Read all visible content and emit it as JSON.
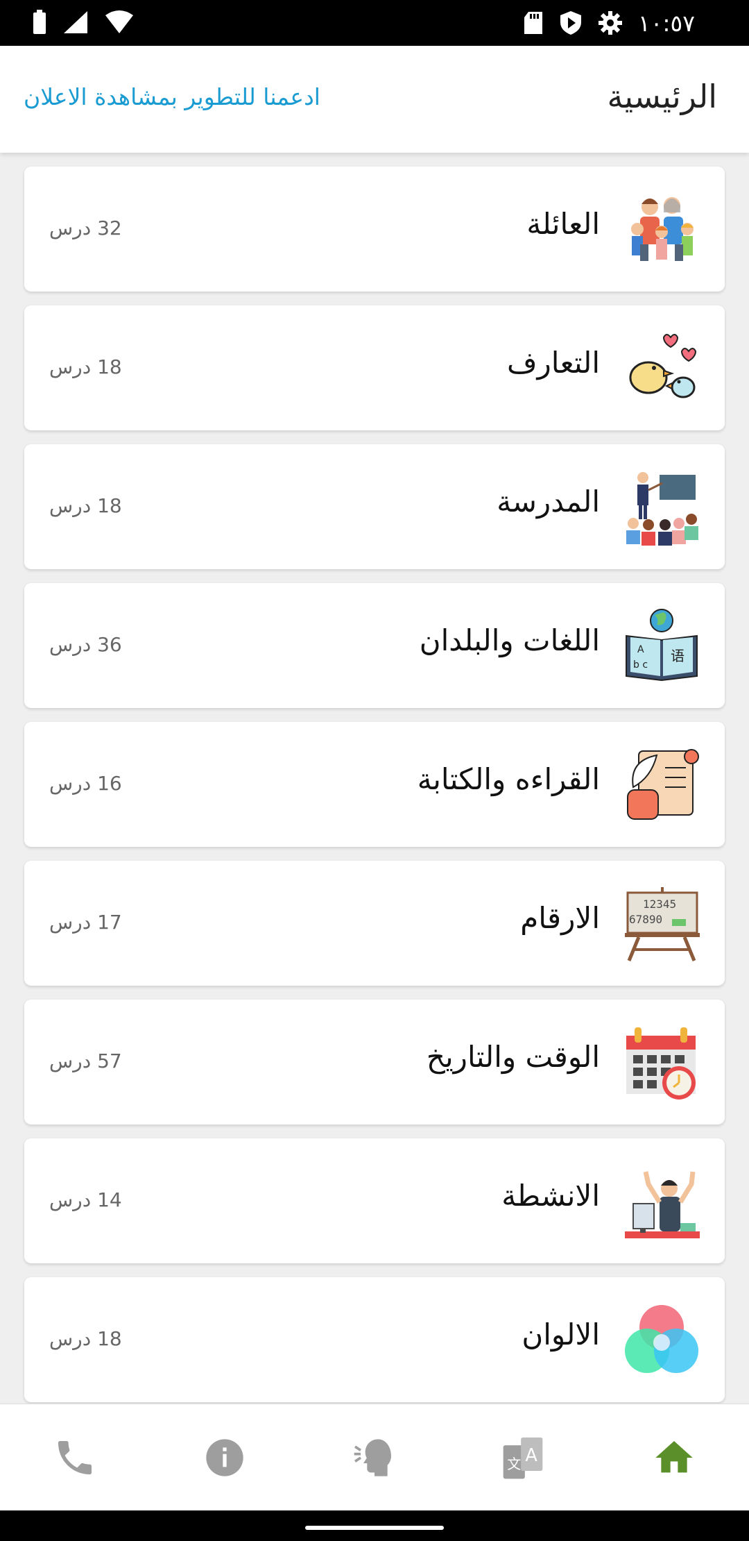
{
  "status_bar": {
    "time": "١٠:٥٧",
    "icons": [
      "battery-icon",
      "signal-icon",
      "wifi-icon",
      "sd-card-icon",
      "shield-play-icon",
      "gear-icon"
    ]
  },
  "app_bar": {
    "title": "الرئيسية",
    "support_link": "ادعمنا للتطوير بمشاهدة الاعلان"
  },
  "categories": [
    {
      "name": "العائلة",
      "count": "32 درس",
      "icon": "family-icon"
    },
    {
      "name": "التعارف",
      "count": "18  درس",
      "icon": "birds-hearts-icon"
    },
    {
      "name": "المدرسة",
      "count": "18  درس",
      "icon": "classroom-icon"
    },
    {
      "name": "اللغات والبلدان",
      "count": "36 درس",
      "icon": "languages-book-icon"
    },
    {
      "name": "القراءه والكتابة",
      "count": "16  درس",
      "icon": "scroll-quill-icon"
    },
    {
      "name": "الارقام",
      "count": "17  درس",
      "icon": "numbers-board-icon"
    },
    {
      "name": "الوقت والتاريخ",
      "count": "57 درس",
      "icon": "calendar-clock-icon"
    },
    {
      "name": "الانشطة",
      "count": "14  درس",
      "icon": "activity-person-icon"
    },
    {
      "name": "الالوان",
      "count": "18  درس",
      "icon": "color-circles-icon"
    }
  ],
  "bottom_nav": [
    {
      "icon": "phone-icon",
      "active": false
    },
    {
      "icon": "info-icon",
      "active": false
    },
    {
      "icon": "speaking-head-icon",
      "active": false
    },
    {
      "icon": "translate-icon",
      "active": false
    },
    {
      "icon": "home-icon",
      "active": true
    }
  ],
  "colors": {
    "accent": "#1a9bd2",
    "active_nav": "#5b8f29",
    "inactive_nav": "#9e9e9e"
  }
}
